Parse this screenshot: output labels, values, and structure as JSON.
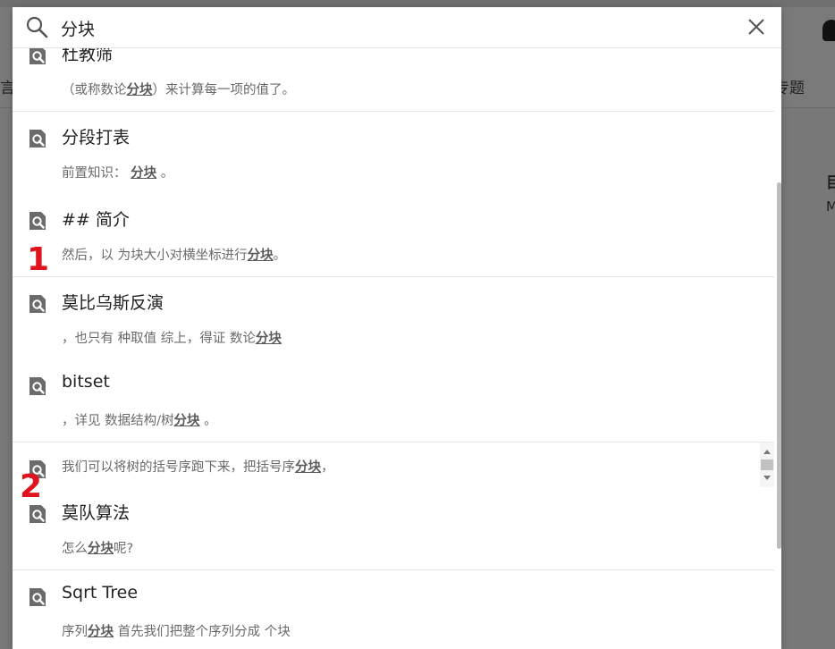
{
  "background": {
    "left_text": "言",
    "right_nav_text": "专题",
    "right_edge_text_1": "目",
    "right_edge_text_2": "M"
  },
  "search": {
    "query": "分块",
    "placeholder": ""
  },
  "results": [
    {
      "title": "杜教筛",
      "snippet_pre": "（或称数论",
      "snippet_hl": "分块",
      "snippet_post": "）来计算每一项的值了。"
    },
    {
      "title": "分段打表",
      "snippet_pre": "前置知识： ",
      "snippet_hl": "分块",
      "snippet_post": " 。"
    },
    {
      "title": "## 简介",
      "snippet_pre": "然后，以 为块大小对横坐标进行",
      "snippet_hl": "分块",
      "snippet_post": "。"
    },
    {
      "title": "莫比乌斯反演",
      "snippet_pre": "，也只有 种取值 综上，得证 数论",
      "snippet_hl": "分块",
      "snippet_post": ""
    },
    {
      "title": "bitset",
      "snippet_pre": "，详见 数据结构/树",
      "snippet_hl": "分块",
      "snippet_post": " 。"
    }
  ],
  "inner_result": {
    "snippet_pre": "我们可以将树的括号序跑下来，把括号序",
    "snippet_hl": "分块",
    "snippet_post": "，"
  },
  "results_after": [
    {
      "title": "莫队算法",
      "snippet_pre": "怎么",
      "snippet_hl": "分块",
      "snippet_post": "呢?"
    },
    {
      "title": "Sqrt Tree",
      "snippet_pre": "序列",
      "snippet_hl": "分块",
      "snippet_post": " 首先我们把整个序列分成 个块"
    }
  ],
  "markers": [
    "1",
    "2"
  ],
  "colors": {
    "accent": "#222222",
    "marker": "#e0141e",
    "overlay": "#787878"
  }
}
